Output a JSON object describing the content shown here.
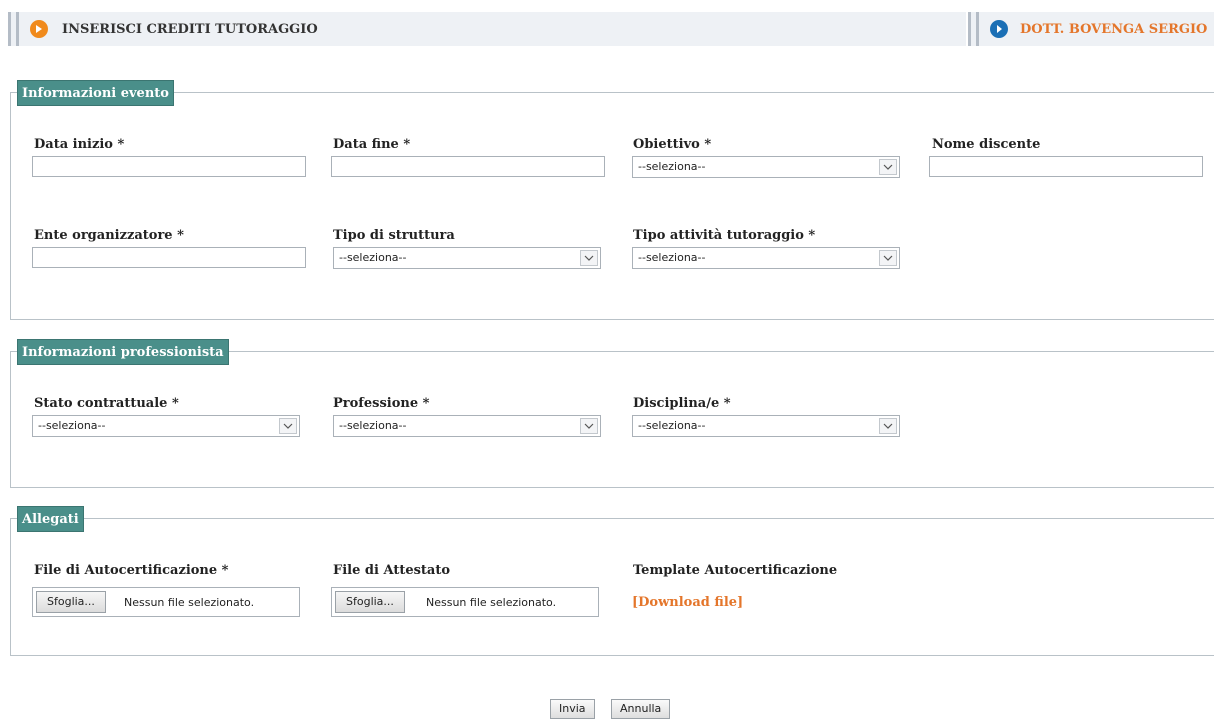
{
  "header": {
    "title": "INSERISCI CREDITI TUTORAGGIO",
    "user_name": "DOTT. BOVENGA SERGIO"
  },
  "sections": {
    "evento": {
      "legend": "Informazioni evento",
      "data_inizio": {
        "label": "Data inizio *",
        "value": ""
      },
      "data_fine": {
        "label": "Data fine *",
        "value": ""
      },
      "obiettivo": {
        "label": "Obiettivo *",
        "selected": "--seleziona--"
      },
      "nome_discente": {
        "label": "Nome discente",
        "value": ""
      },
      "ente_organizzatore": {
        "label": "Ente organizzatore *",
        "value": ""
      },
      "tipo_struttura": {
        "label": "Tipo di struttura",
        "selected": "--seleziona--"
      },
      "tipo_attivita": {
        "label": "Tipo attività tutoraggio *",
        "selected": "--seleziona--"
      }
    },
    "professionista": {
      "legend": "Informazioni professionista",
      "stato_contrattuale": {
        "label": "Stato contrattuale *",
        "selected": "--seleziona--"
      },
      "professione": {
        "label": "Professione *",
        "selected": "--seleziona--"
      },
      "disciplina": {
        "label": "Disciplina/e *",
        "selected": "--seleziona--"
      }
    },
    "allegati": {
      "legend": "Allegati",
      "file_autocertificazione": {
        "label": "File di Autocertificazione *",
        "browse": "Sfoglia...",
        "status": "Nessun file selezionato."
      },
      "file_attestato": {
        "label": "File di Attestato",
        "browse": "Sfoglia...",
        "status": "Nessun file selezionato."
      },
      "template": {
        "label": "Template Autocertificazione",
        "link": "[Download file]"
      }
    }
  },
  "actions": {
    "submit": "Invia",
    "cancel": "Annulla"
  },
  "colors": {
    "accent_orange": "#e4762b",
    "legend_teal": "#4a8f8a",
    "info_blue": "#1a6fb5"
  }
}
